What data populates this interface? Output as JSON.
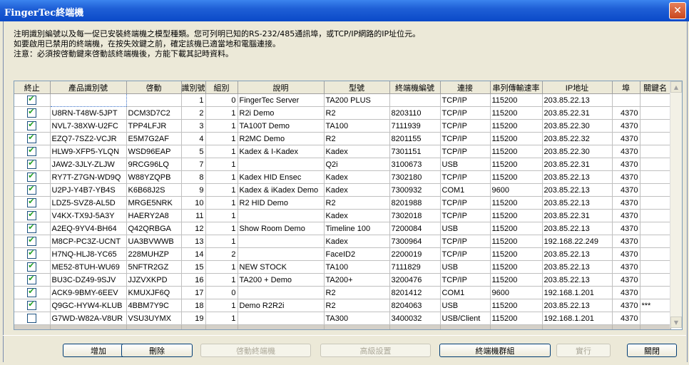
{
  "window": {
    "title": "FingerTec終端機",
    "close_glyph": "✕"
  },
  "notes": [
    "注明識別編號以及每一促已安裝終端機之模型種類。您可列明已知的RS-232/485通訊埠，或TCP/IP網路的IP址位元。",
    "如要啟用已禁用的終端機，在按失效鍵之前，確定該機已適當地和電腦連接。",
    "注意：必須按啓動鍵來啓動該終端機後，方能下載其記時資料。"
  ],
  "columns": [
    "終止",
    "產品識別號",
    "啓動",
    "識別號",
    "組別",
    "說明",
    "型號",
    "終端機編號",
    "連接",
    "串列傳輸速率",
    "IP地址",
    "埠",
    "關鍵名"
  ],
  "rows": [
    {
      "on": true,
      "serial": "",
      "act": "",
      "id": "1",
      "grp": "0",
      "desc": "FingerTec Server",
      "model": "TA200 PLUS",
      "term": "",
      "conn": "TCP/IP",
      "baud": "115200",
      "ip": "203.85.22.13",
      "port": "",
      "key": ""
    },
    {
      "on": true,
      "serial": "U8RN-T48W-5JPT",
      "act": "DCM3D7C2",
      "id": "2",
      "grp": "1",
      "desc": "R2i Demo",
      "model": "R2",
      "term": "8203110",
      "conn": "TCP/IP",
      "baud": "115200",
      "ip": "203.85.22.31",
      "port": "4370",
      "key": ""
    },
    {
      "on": true,
      "serial": "NVL7-38XW-U2FC",
      "act": "TPP4LFJR",
      "id": "3",
      "grp": "1",
      "desc": "TA100T Demo",
      "model": "TA100",
      "term": "7111939",
      "conn": "TCP/IP",
      "baud": "115200",
      "ip": "203.85.22.30",
      "port": "4370",
      "key": ""
    },
    {
      "on": true,
      "serial": "EZQ7-7SZ2-VCJR",
      "act": "E5M7G2AF",
      "id": "4",
      "grp": "1",
      "desc": "R2MC Demo",
      "model": "R2",
      "term": "8201155",
      "conn": "TCP/IP",
      "baud": "115200",
      "ip": "203.85.22.32",
      "port": "4370",
      "key": ""
    },
    {
      "on": true,
      "serial": "HLW9-XFP5-YLQN",
      "act": "WSD96EAP",
      "id": "5",
      "grp": "1",
      "desc": "Kadex & I-Kadex",
      "model": "Kadex",
      "term": "7301151",
      "conn": "TCP/IP",
      "baud": "115200",
      "ip": "203.85.22.30",
      "port": "4370",
      "key": ""
    },
    {
      "on": true,
      "serial": "JAW2-3JLY-ZLJW",
      "act": "9RCG96LQ",
      "id": "7",
      "grp": "1",
      "desc": "",
      "model": "Q2i",
      "term": "3100673",
      "conn": "USB",
      "baud": "115200",
      "ip": "203.85.22.31",
      "port": "4370",
      "key": ""
    },
    {
      "on": true,
      "serial": "RY7T-Z7GN-WD9Q",
      "act": "W88YZQPB",
      "id": "8",
      "grp": "1",
      "desc": "Kadex HID Ensec",
      "model": "Kadex",
      "term": "7302180",
      "conn": "TCP/IP",
      "baud": "115200",
      "ip": "203.85.22.13",
      "port": "4370",
      "key": ""
    },
    {
      "on": true,
      "serial": "U2PJ-Y4B7-YB4S",
      "act": "K6B68J2S",
      "id": "9",
      "grp": "1",
      "desc": "Kadex & iKadex Demo",
      "model": "Kadex",
      "term": "7300932",
      "conn": "COM1",
      "baud": "9600",
      "ip": "203.85.22.13",
      "port": "4370",
      "key": ""
    },
    {
      "on": true,
      "serial": "LDZ5-SVZ8-AL5D",
      "act": "MRGE5NRK",
      "id": "10",
      "grp": "1",
      "desc": "R2 HID Demo",
      "model": "R2",
      "term": "8201988",
      "conn": "TCP/IP",
      "baud": "115200",
      "ip": "203.85.22.13",
      "port": "4370",
      "key": ""
    },
    {
      "on": true,
      "serial": "V4KX-TX9J-5A3Y",
      "act": "HAERY2A8",
      "id": "11",
      "grp": "1",
      "desc": "",
      "model": "Kadex",
      "term": "7302018",
      "conn": "TCP/IP",
      "baud": "115200",
      "ip": "203.85.22.31",
      "port": "4370",
      "key": ""
    },
    {
      "on": true,
      "serial": "A2EQ-9YV4-BH64",
      "act": "Q42QRBGA",
      "id": "12",
      "grp": "1",
      "desc": "Show Room Demo",
      "model": "Timeline 100",
      "term": "7200084",
      "conn": "USB",
      "baud": "115200",
      "ip": "203.85.22.13",
      "port": "4370",
      "key": ""
    },
    {
      "on": true,
      "serial": "M8CP-PC3Z-UCNT",
      "act": "UA3BVWWB",
      "id": "13",
      "grp": "1",
      "desc": "",
      "model": "Kadex",
      "term": "7300964",
      "conn": "TCP/IP",
      "baud": "115200",
      "ip": "192.168.22.249",
      "port": "4370",
      "key": ""
    },
    {
      "on": true,
      "serial": "H7NQ-HLJ8-YC65",
      "act": "228MUHZP",
      "id": "14",
      "grp": "2",
      "desc": "",
      "model": "FaceID2",
      "term": "2200019",
      "conn": "TCP/IP",
      "baud": "115200",
      "ip": "203.85.22.13",
      "port": "4370",
      "key": ""
    },
    {
      "on": true,
      "serial": "ME52-8TUH-WU69",
      "act": "5NFTR2GZ",
      "id": "15",
      "grp": "1",
      "desc": "NEW STOCK",
      "model": "TA100",
      "term": "7111829",
      "conn": "USB",
      "baud": "115200",
      "ip": "203.85.22.13",
      "port": "4370",
      "key": ""
    },
    {
      "on": true,
      "serial": "BU3C-DZ49-9SJV",
      "act": "JJZVXKPD",
      "id": "16",
      "grp": "1",
      "desc": "TA200 + Demo",
      "model": "TA200+",
      "term": "3200476",
      "conn": "TCP/IP",
      "baud": "115200",
      "ip": "203.85.22.13",
      "port": "4370",
      "key": ""
    },
    {
      "on": true,
      "serial": "ACK9-9BMY-6EEV",
      "act": "KMUXJF6Q",
      "id": "17",
      "grp": "0",
      "desc": "",
      "model": "R2",
      "term": "8201412",
      "conn": "COM1",
      "baud": "9600",
      "ip": "192.168.1.201",
      "port": "4370",
      "key": ""
    },
    {
      "on": true,
      "serial": "Q9GC-HYW4-KLUB",
      "act": "4BBM7Y9C",
      "id": "18",
      "grp": "1",
      "desc": "Demo  R2R2i",
      "model": "R2",
      "term": "8204063",
      "conn": "USB",
      "baud": "115200",
      "ip": "203.85.22.13",
      "port": "4370",
      "key": "***"
    },
    {
      "on": false,
      "serial": "G7WD-W82A-V8UR",
      "act": "VSU3UYMX",
      "id": "19",
      "grp": "1",
      "desc": "",
      "model": "TA300",
      "term": "3400032",
      "conn": "USB/Client",
      "baud": "115200",
      "ip": "192.168.1.201",
      "port": "4370",
      "key": ""
    }
  ],
  "buttons": {
    "add": "增加",
    "delete": "刪除",
    "activate": "啓動終端機",
    "advanced": "高級設置",
    "group": "終端機群組",
    "apply": "實行",
    "close": "關閉"
  },
  "scroll": {
    "up": "▲",
    "down": "▼"
  }
}
